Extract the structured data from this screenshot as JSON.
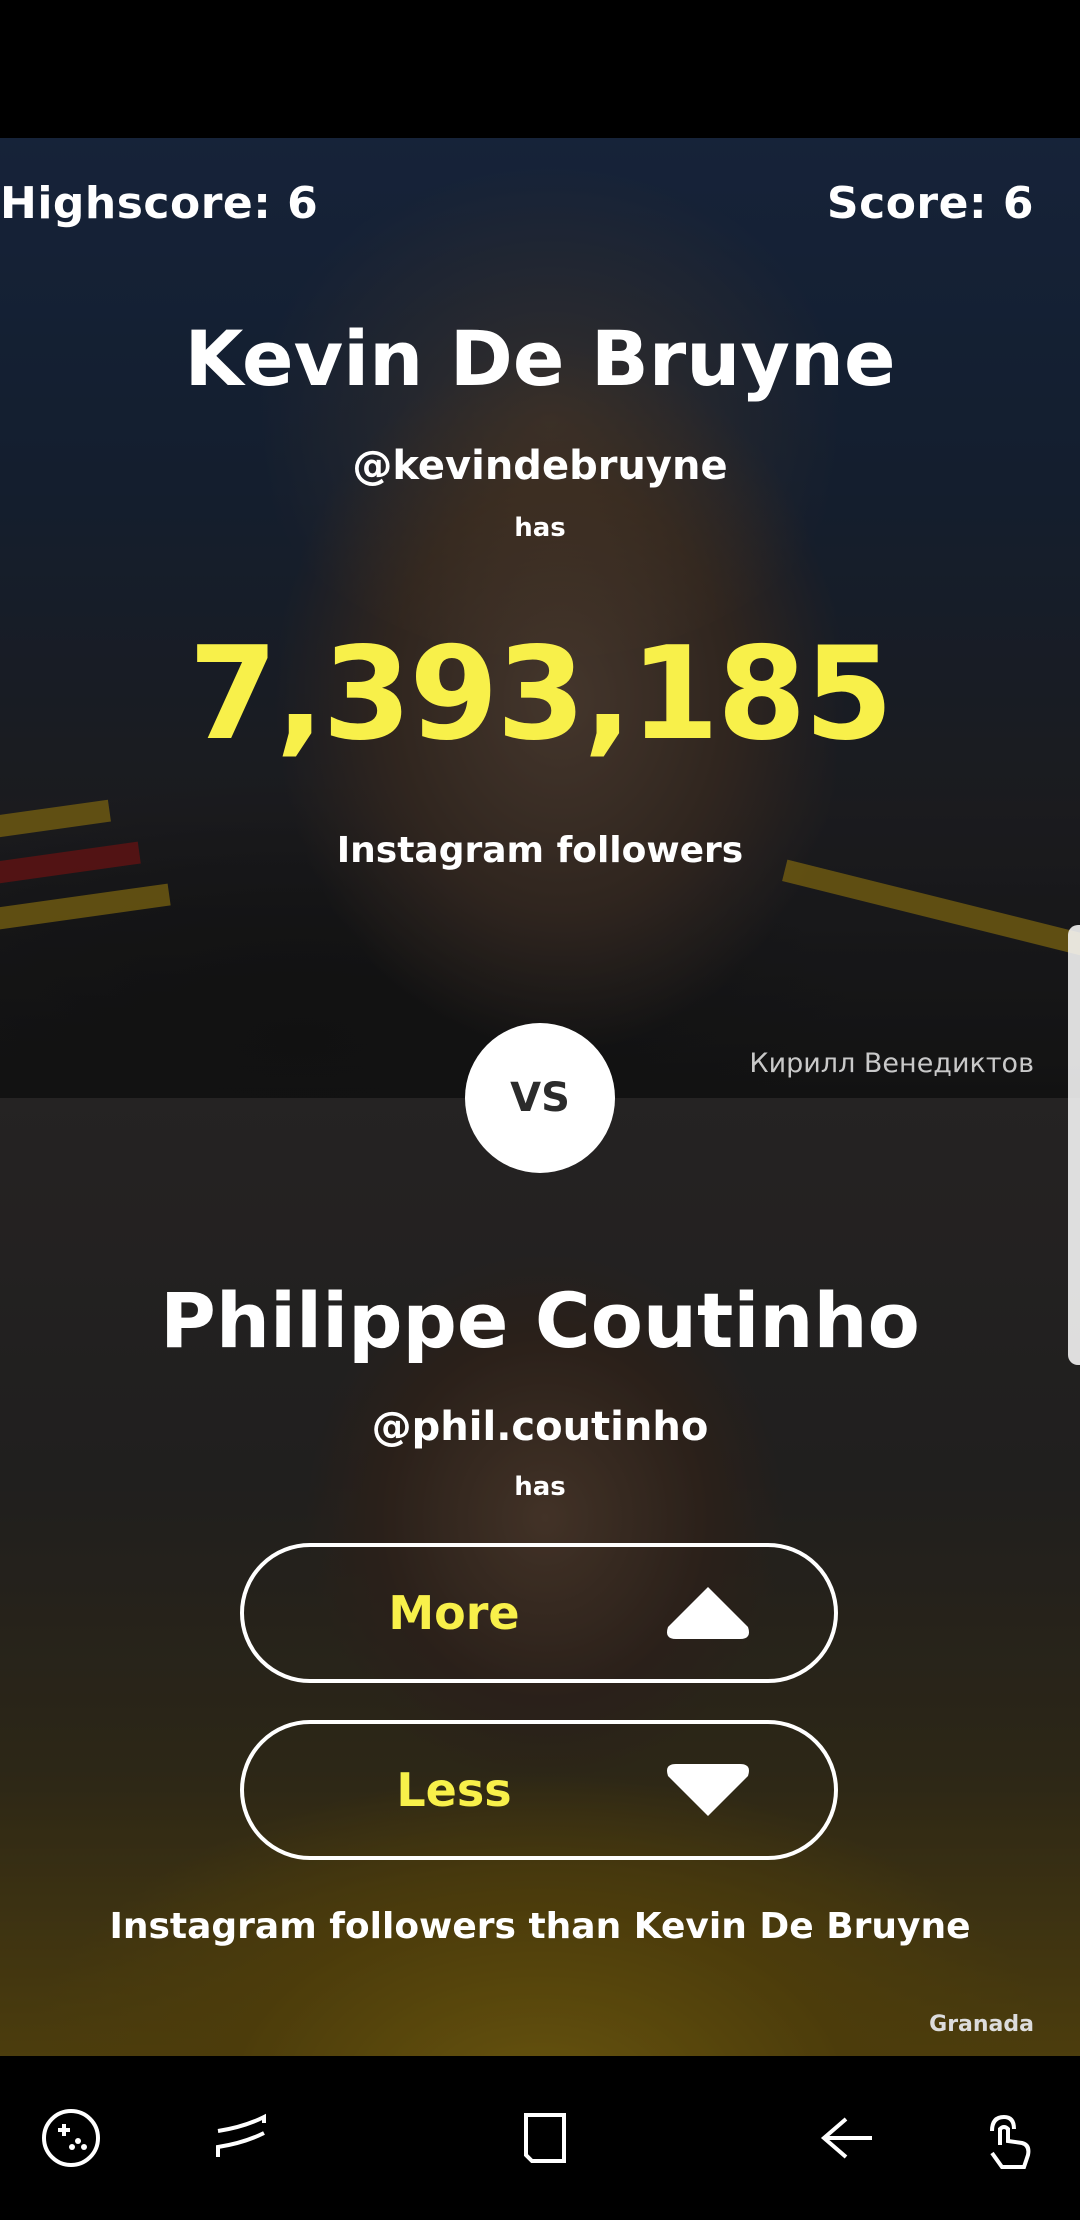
{
  "scores": {
    "highscore": "Highscore: 6",
    "score": "Score: 6"
  },
  "top_person": {
    "name": "Kevin De Bruyne",
    "handle": "@kevindebruyne",
    "has": "has",
    "followers": "7,393,185",
    "label": "Instagram followers",
    "photo_credit": "Кирилл Венедиктов"
  },
  "vs": "VS",
  "bottom_person": {
    "name": "Philippe Coutinho",
    "handle": "@phil.coutinho",
    "has": "has",
    "photo_credit": "Granada"
  },
  "buttons": {
    "more": "More",
    "less": "Less",
    "more_icon": "arrow-up-icon",
    "less_icon": "arrow-down-icon"
  },
  "comparison_text": "Instagram followers than Kevin De Bruyne",
  "nav_icons": [
    "game-tools-icon",
    "recents-icon",
    "home-icon",
    "back-icon",
    "touch-gesture-icon"
  ],
  "colors": {
    "accent_yellow": "#f8f04a",
    "text_white": "#ffffff",
    "vs_circle": "#ffffff"
  }
}
